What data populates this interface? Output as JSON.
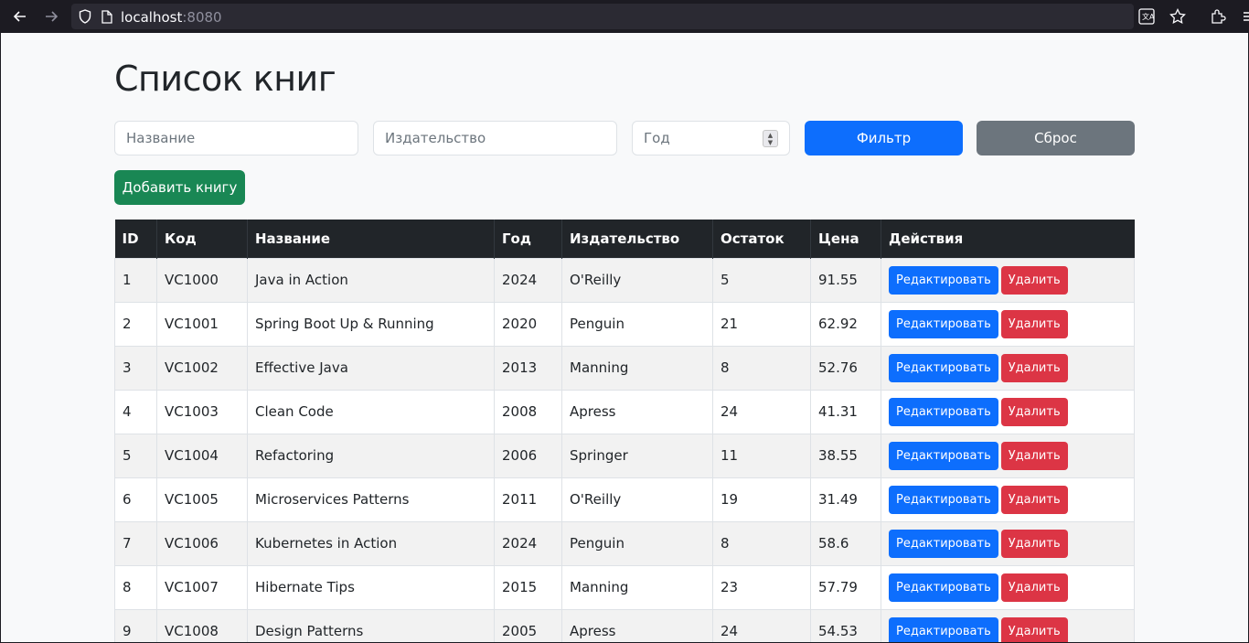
{
  "browser": {
    "url_host": "localhost",
    "url_port": ":8080"
  },
  "page": {
    "title": "Список книг"
  },
  "filters": {
    "name_placeholder": "Название",
    "publisher_placeholder": "Издательство",
    "year_placeholder": "Год",
    "filter_label": "Фильтр",
    "reset_label": "Сброс"
  },
  "add_button_label": "Добавить книгу",
  "table": {
    "headers": [
      "ID",
      "Код",
      "Название",
      "Год",
      "Издательство",
      "Остаток",
      "Цена",
      "Действия"
    ],
    "edit_label": "Редактировать",
    "delete_label": "Удалить",
    "rows": [
      {
        "id": "1",
        "code": "VC1000",
        "name": "Java in Action",
        "year": "2024",
        "publisher": "O'Reilly",
        "stock": "5",
        "price": "91.55"
      },
      {
        "id": "2",
        "code": "VC1001",
        "name": "Spring Boot Up & Running",
        "year": "2020",
        "publisher": "Penguin",
        "stock": "21",
        "price": "62.92"
      },
      {
        "id": "3",
        "code": "VC1002",
        "name": "Effective Java",
        "year": "2013",
        "publisher": "Manning",
        "stock": "8",
        "price": "52.76"
      },
      {
        "id": "4",
        "code": "VC1003",
        "name": "Clean Code",
        "year": "2008",
        "publisher": "Apress",
        "stock": "24",
        "price": "41.31"
      },
      {
        "id": "5",
        "code": "VC1004",
        "name": "Refactoring",
        "year": "2006",
        "publisher": "Springer",
        "stock": "11",
        "price": "38.55"
      },
      {
        "id": "6",
        "code": "VC1005",
        "name": "Microservices Patterns",
        "year": "2011",
        "publisher": "O'Reilly",
        "stock": "19",
        "price": "31.49"
      },
      {
        "id": "7",
        "code": "VC1006",
        "name": "Kubernetes in Action",
        "year": "2024",
        "publisher": "Penguin",
        "stock": "8",
        "price": "58.6"
      },
      {
        "id": "8",
        "code": "VC1007",
        "name": "Hibernate Tips",
        "year": "2015",
        "publisher": "Manning",
        "stock": "23",
        "price": "57.79"
      },
      {
        "id": "9",
        "code": "VC1008",
        "name": "Design Patterns",
        "year": "2005",
        "publisher": "Apress",
        "stock": "24",
        "price": "54.53"
      }
    ]
  }
}
